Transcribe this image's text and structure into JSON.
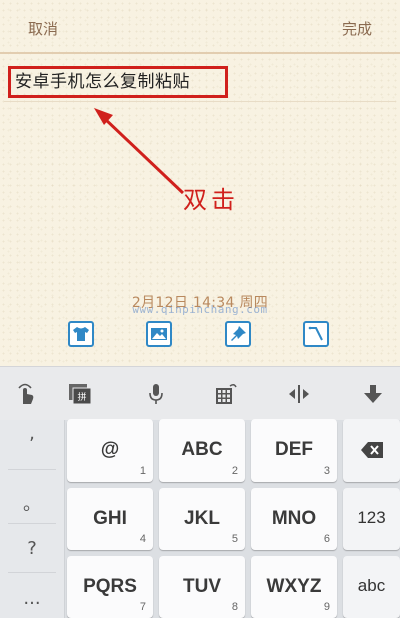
{
  "topbar": {
    "cancel_label": "取消",
    "done_label": "完成"
  },
  "note": {
    "text": "安卓手机怎么复制粘贴",
    "annotation": "双击",
    "datetime": "2月12日 14:34 周四",
    "watermark": "www.qinpinchang.com"
  },
  "toolbar_icons": [
    "shirt-icon",
    "image-icon",
    "pushpin-icon",
    "clock-icon"
  ],
  "keyboard_toolbar_icons": [
    "gesture-hand-icon",
    "pinyin-icon",
    "microphone-icon",
    "numpad-switch-icon",
    "cursor-move-icon",
    "hide-keyboard-icon"
  ],
  "keyboard": {
    "left_column": [
      ",",
      "。",
      "?",
      "..."
    ],
    "rows": [
      [
        {
          "main": "@",
          "sub": "1"
        },
        {
          "main": "ABC",
          "sub": "2"
        },
        {
          "main": "DEF",
          "sub": "3"
        }
      ],
      [
        {
          "main": "GHI",
          "sub": "4"
        },
        {
          "main": "JKL",
          "sub": "5"
        },
        {
          "main": "MNO",
          "sub": "6"
        }
      ],
      [
        {
          "main": "PQRS",
          "sub": "7"
        },
        {
          "main": "TUV",
          "sub": "8"
        },
        {
          "main": "WXYZ",
          "sub": "9"
        }
      ]
    ],
    "right_column": [
      {
        "label": "",
        "icon": "backspace-icon"
      },
      {
        "label": "123"
      },
      {
        "label": "abc"
      }
    ]
  },
  "colors": {
    "accent_red": "#d0201c",
    "toolbar_blue": "#2f88c6",
    "label_brown": "#8a6a4f"
  }
}
